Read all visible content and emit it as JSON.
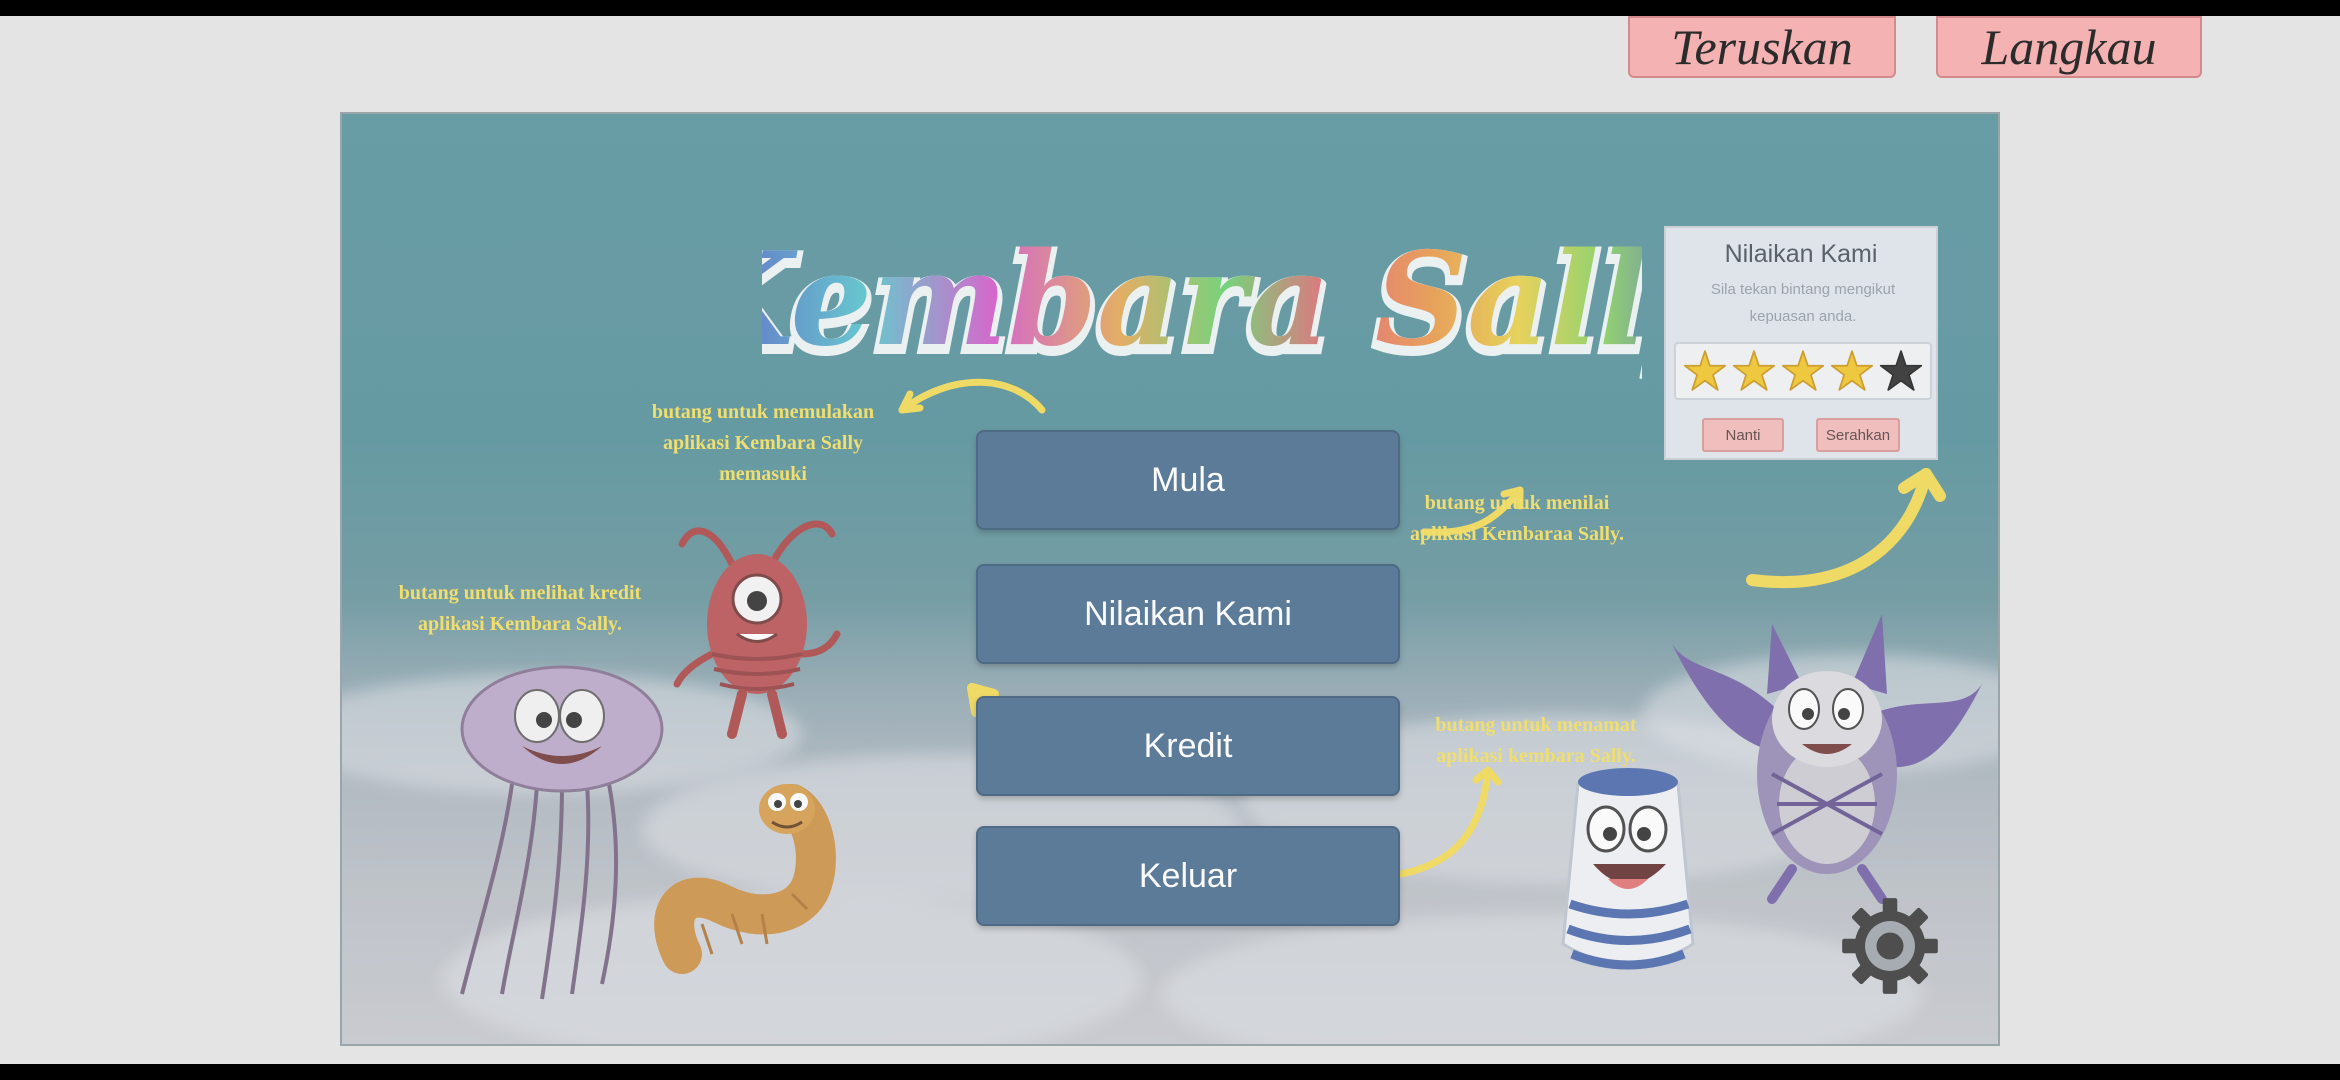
{
  "top_bar": {
    "next_label": "Teruskan",
    "skip_label": "Langkau"
  },
  "game": {
    "title": "Kembara Sally",
    "menu": {
      "start": "Mula",
      "rate": "Nilaikan Kami",
      "credits": "Kredit",
      "exit": "Keluar"
    },
    "notes": {
      "start": "butang untuk memulakan aplikasi Kembara Sally memasuki",
      "rate": "butang untuk menilai aplikasi Kembaraa Sally.",
      "credits": "butang untuk melihat kredit aplikasi Kembara Sally.",
      "exit": "butang untuk menamat aplikasi kembara Sally."
    },
    "rating_card": {
      "title": "Nilaikan Kami",
      "subtitle": "Sila tekan bintang mengikut kepuasan anda.",
      "later": "Nanti",
      "submit": "Serahkan",
      "stars_filled": 4,
      "stars_total": 5
    },
    "settings_icon": "gear-icon"
  },
  "colors": {
    "button_blue": "#3e6488",
    "note_yellow": "#f3dd55",
    "pink_button": "#f4b2b2"
  }
}
